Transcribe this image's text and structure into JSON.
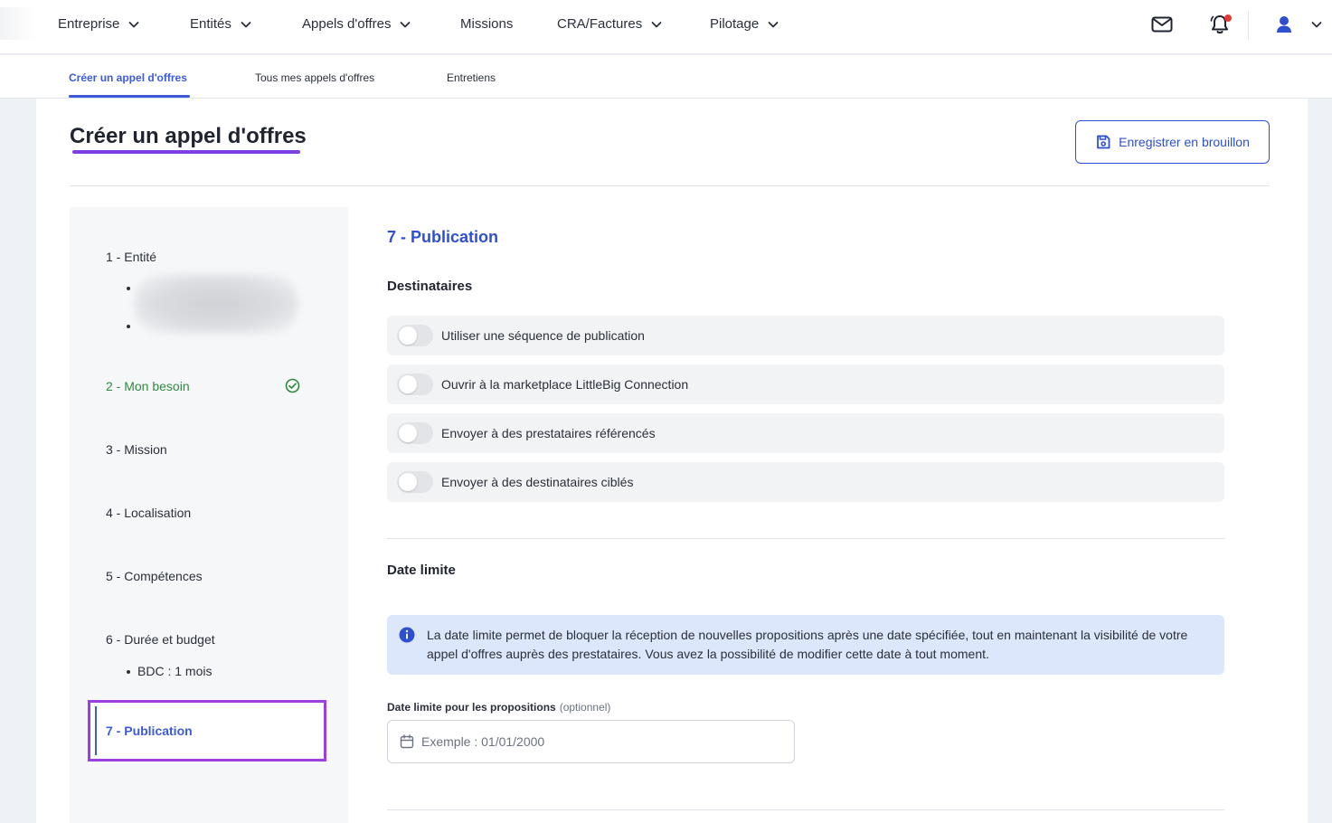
{
  "nav": {
    "items": [
      {
        "label": "Entreprise",
        "dropdown": true
      },
      {
        "label": "Entités",
        "dropdown": true
      },
      {
        "label": "Appels d'offres",
        "dropdown": true
      },
      {
        "label": "Missions",
        "dropdown": false
      },
      {
        "label": "CRA/Factures",
        "dropdown": true
      },
      {
        "label": "Pilotage",
        "dropdown": true
      }
    ],
    "icons": [
      "mail-icon",
      "bell-icon",
      "user-icon"
    ]
  },
  "subnav": {
    "tabs": [
      {
        "label": "Créer un appel d'offres",
        "active": true
      },
      {
        "label": "Tous mes appels d'offres",
        "active": false
      },
      {
        "label": "Entretiens",
        "active": false
      }
    ]
  },
  "page": {
    "title": "Créer un appel d'offres",
    "draft_button": "Enregistrer en brouillon"
  },
  "steps": [
    {
      "label": "1 - Entité",
      "state": "default"
    },
    {
      "label": "2 - Mon besoin",
      "state": "done"
    },
    {
      "label": "3 - Mission",
      "state": "default"
    },
    {
      "label": "4 - Localisation",
      "state": "default"
    },
    {
      "label": "5 - Compétences",
      "state": "default"
    },
    {
      "label": "6 - Durée et budget",
      "state": "default",
      "sub": "BDC : 1 mois"
    },
    {
      "label": "7 - Publication",
      "state": "current"
    }
  ],
  "publication": {
    "title": "7 - Publication",
    "recipients_heading": "Destinataires",
    "toggles": [
      {
        "label": "Utiliser une séquence de publication",
        "on": false
      },
      {
        "label": "Ouvrir à la marketplace LittleBig Connection",
        "on": false
      },
      {
        "label": "Envoyer à des prestataires référencés",
        "on": false
      },
      {
        "label": "Envoyer à des destinataires ciblés",
        "on": false
      }
    ],
    "deadline_heading": "Date limite",
    "info": "La date limite permet de bloquer la réception de nouvelles propositions après une date spécifiée, tout en maintenant la visibilité de votre appel d'offres auprès des prestataires. Vous avez la possibilité de modifier cette date à tout moment.",
    "field_label": "Date limite pour les propositions",
    "field_optional": "(optionnel)",
    "field_placeholder": "Exemple : 01/01/2000",
    "field_value": ""
  },
  "colors": {
    "primary": "#2f4fd1",
    "accent_purple": "#7b3fe4",
    "success": "#2f8a3e",
    "notification": "#e53935",
    "info_bg": "#dce7fb"
  }
}
